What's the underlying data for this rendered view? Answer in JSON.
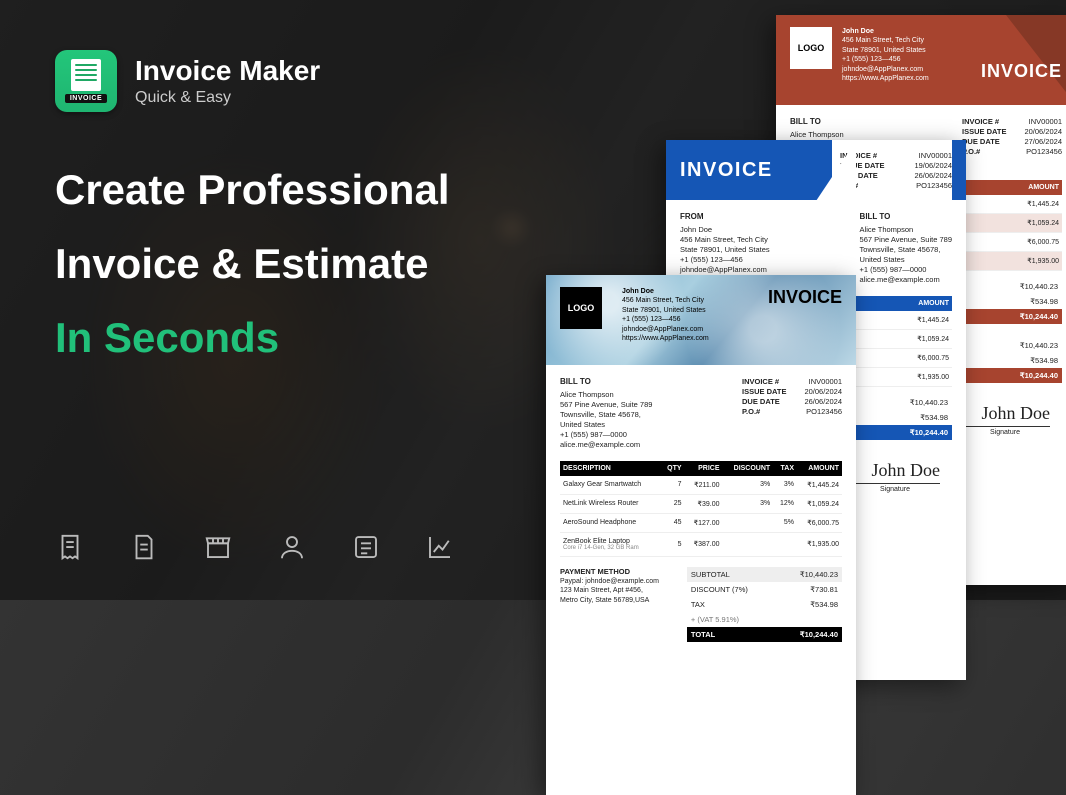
{
  "brand": {
    "title": "Invoice Maker",
    "subtitle": "Quick & Easy",
    "iconLabel": "INVOICE"
  },
  "headline": {
    "line1": "Create Professional",
    "line2": "Invoice & Estimate",
    "line3": "In Seconds"
  },
  "common": {
    "logoText": "LOGO",
    "invoiceWord": "INVOICE",
    "from": {
      "name": "John Doe",
      "street": "456 Main Street, Tech City",
      "state": "State 78901, United States",
      "phone": "+1 (555) 123—456",
      "email": "johndoe@AppPlanex.com",
      "url": "https://www.AppPlanex.com"
    },
    "billTo": {
      "label": "BILL TO",
      "name": "Alice Thompson",
      "street": "567 Pine Avenue, Suite 789",
      "city": "Townsville, State 45678,",
      "country": "United States",
      "phone": "+1 (555) 987—0000",
      "email": "alice.me@example.com"
    },
    "meta": {
      "invoiceNoLbl": "INVOICE #",
      "invoiceNo": "INV00001",
      "issueLbl": "ISSUE DATE",
      "dueLbl": "DUE DATE",
      "poLbl": "P.O.#",
      "po": "PO123456"
    },
    "cols": {
      "desc": "DESCRIPTION",
      "qty": "QTY",
      "price": "PRICE",
      "disc": "DISCOUNT",
      "tax": "TAX",
      "amt": "AMOUNT"
    },
    "items": [
      {
        "desc": "Galaxy Gear Smartwatch",
        "qty": "7",
        "price": "₹211.00",
        "disc": "3%",
        "tax": "3%",
        "amt": "₹1,445.24"
      },
      {
        "desc": "NetLink Wireless Router",
        "qty": "25",
        "price": "₹39.00",
        "disc": "3%",
        "tax": "12%",
        "amt": "₹1,059.24"
      },
      {
        "desc": "AeroSound Headphone",
        "qty": "45",
        "price": "₹127.00",
        "disc": "",
        "tax": "5%",
        "amt": "₹6,000.75"
      },
      {
        "desc": "ZenBook Elite Laptop",
        "sub": "Core i7 14-Gen, 32 GB Ram",
        "qty": "5",
        "price": "₹387.00",
        "disc": "",
        "tax": "",
        "amt": "₹1,935.00"
      }
    ],
    "totals": {
      "subtotalLbl": "SUBTOTAL",
      "subtotal": "₹10,440.23",
      "discountLbl": "DISCOUNT (7%)",
      "discount": "₹730.81",
      "taxLbl": "TAX",
      "tax": "₹534.98",
      "vatLbl": "+ (VAT 5.91%)",
      "totalLbl": "TOTAL",
      "total": "₹10,244.40"
    },
    "signature": {
      "name": "John Doe",
      "label": "Signature"
    }
  },
  "redCard": {
    "issue": "20/06/2024",
    "due": "27/06/2024"
  },
  "blueCard": {
    "issue": "19/06/2024",
    "due": "26/06/2024",
    "fromLbl": "FROM"
  },
  "frontCard": {
    "issue": "20/06/2024",
    "due": "26/06/2024",
    "payment": {
      "lbl": "PAYMENT METHOD",
      "line1": "Paypal: johndoe@example.com",
      "line2": "123 Main Street, Apt #456,",
      "line3": "Metro City, State 56789,USA"
    }
  }
}
